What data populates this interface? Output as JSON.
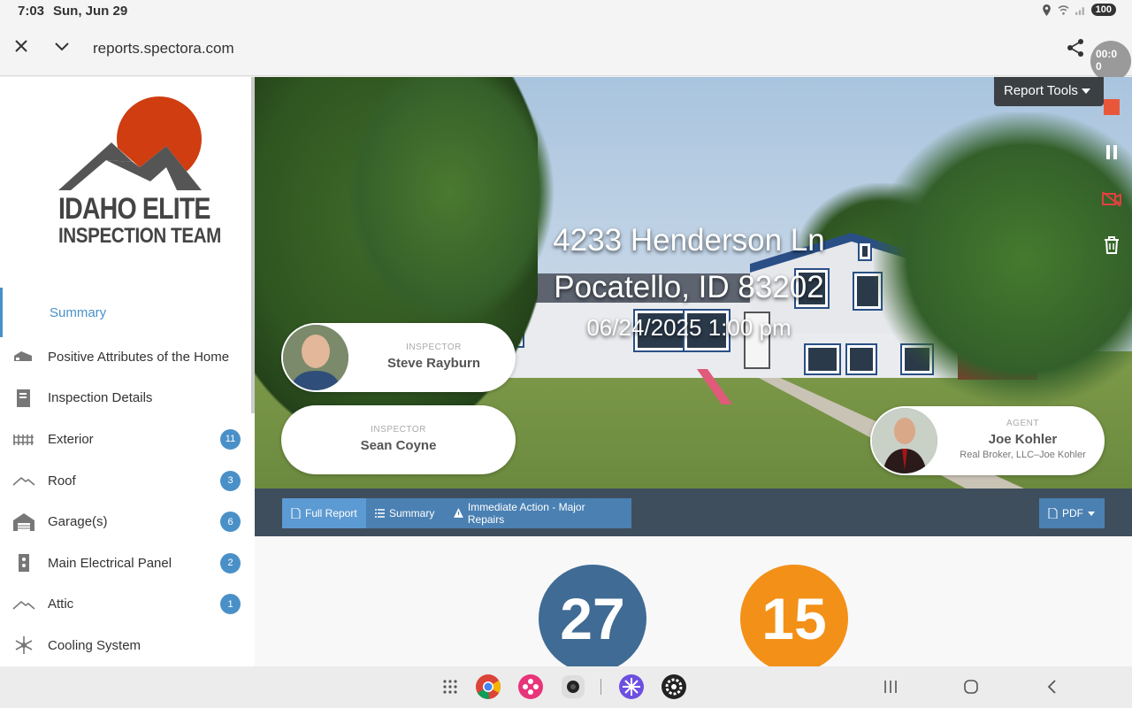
{
  "status_bar": {
    "time": "7:03",
    "date": "Sun, Jun 29",
    "battery": "100"
  },
  "browser": {
    "url": "reports.spectora.com",
    "timer": "00:0\n0"
  },
  "logo": {
    "line1": "IDAHO ELITE",
    "line2": "INSPECTION TEAM"
  },
  "sidebar": {
    "active_item": "Summary",
    "items": [
      {
        "label": "Positive Attributes of the Home",
        "icon": "house-side-icon",
        "badge": ""
      },
      {
        "label": "Inspection Details",
        "icon": "document-icon",
        "badge": ""
      },
      {
        "label": "Exterior",
        "icon": "fence-icon",
        "badge": "11"
      },
      {
        "label": "Roof",
        "icon": "roof-icon",
        "badge": "3"
      },
      {
        "label": "Garage(s)",
        "icon": "garage-icon",
        "badge": "6"
      },
      {
        "label": "Main Electrical Panel",
        "icon": "panel-icon",
        "badge": "2"
      },
      {
        "label": "Attic",
        "icon": "attic-icon",
        "badge": "1"
      },
      {
        "label": "Cooling System",
        "icon": "snowflake-icon",
        "badge": ""
      }
    ]
  },
  "hero": {
    "address_line1": "4233 Henderson Ln",
    "address_line2": "Pocatello, ID 83202",
    "datetime": "06/24/2025 1:00 pm",
    "report_tools_label": "Report Tools",
    "inspector1": {
      "role": "INSPECTOR",
      "name": "Steve Rayburn"
    },
    "inspector2": {
      "role": "INSPECTOR",
      "name": "Sean Coyne"
    },
    "agent": {
      "role": "AGENT",
      "name": "Joe Kohler",
      "company": "Real Broker, LLC–Joe Kohler"
    }
  },
  "tabs": {
    "full_report": "Full Report",
    "summary": "Summary",
    "immediate": "Immediate Action - Major Repairs",
    "pdf": "PDF"
  },
  "summary_counts": {
    "first": "27",
    "second": "15"
  },
  "colors": {
    "accent": "#4a90c8",
    "count_blue": "#3f6b94",
    "count_orange": "#f39018",
    "tab_bar": "#3f4e5d"
  }
}
